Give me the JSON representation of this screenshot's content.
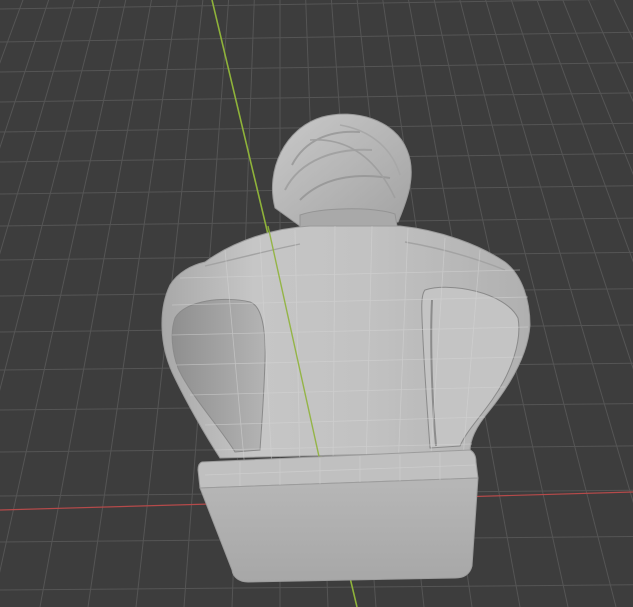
{
  "viewport": {
    "background": "#3d3d3d",
    "grid_color": "#555555",
    "y_axis_color": "#8fb33a",
    "x_axis_color": "#b54a4a",
    "mesh_color": "#bcbcbc",
    "overlay_grid_color": "#d4d4d4"
  },
  "mesh": {
    "name": "bust-model",
    "view": "back"
  }
}
